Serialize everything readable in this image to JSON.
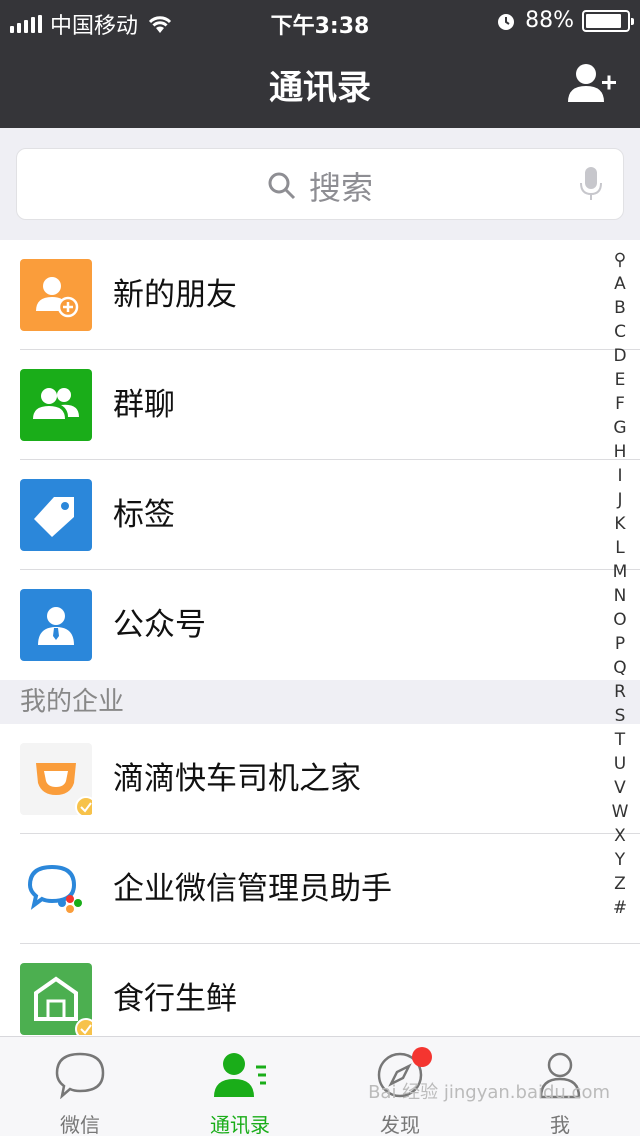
{
  "status_bar": {
    "carrier": "中国移动",
    "time": "下午3:38",
    "battery": "88%",
    "battery_level": 0.88
  },
  "nav": {
    "title": "通讯录",
    "add_icon": "add-contact-icon"
  },
  "search": {
    "placeholder": "搜索"
  },
  "functions": [
    {
      "label": "新的朋友",
      "icon": "new-friend-icon",
      "color": "#fa9d3b"
    },
    {
      "label": "群聊",
      "icon": "group-chat-icon",
      "color": "#1aad19"
    },
    {
      "label": "标签",
      "icon": "tag-icon",
      "color": "#2b87da"
    },
    {
      "label": "公众号",
      "icon": "official-account-icon",
      "color": "#2b87da"
    }
  ],
  "section": {
    "title": "我的企业"
  },
  "enterprise": [
    {
      "label": "滴滴快车司机之家",
      "icon": "didi-icon"
    },
    {
      "label": "企业微信管理员助手",
      "icon": "wework-icon"
    },
    {
      "label": "食行生鲜",
      "icon": "fresh-food-icon"
    }
  ],
  "index": [
    "Q",
    "A",
    "B",
    "C",
    "D",
    "E",
    "F",
    "G",
    "H",
    "I",
    "J",
    "K",
    "L",
    "M",
    "N",
    "O",
    "P",
    "Q",
    "R",
    "S",
    "T",
    "U",
    "V",
    "W",
    "X",
    "Y",
    "Z",
    "#"
  ],
  "tabs": [
    {
      "label": "微信",
      "icon": "chat-icon",
      "active": false
    },
    {
      "label": "通讯录",
      "icon": "contacts-icon",
      "active": true
    },
    {
      "label": "发现",
      "icon": "discover-icon",
      "active": false,
      "badge": true
    },
    {
      "label": "我",
      "icon": "me-icon",
      "active": false
    }
  ],
  "watermark": "Bai 经验 jingyan.baidu.com",
  "colors": {
    "nav_bg": "#353539",
    "accent": "#1aad19",
    "badge": "#f43530"
  }
}
